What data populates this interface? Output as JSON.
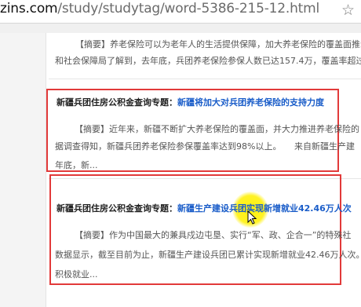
{
  "browser": {
    "url_host": "zins.com",
    "url_path": "/study/studytag/word-5386-215-12.html"
  },
  "article1": {
    "line1": "【摘要】养老保险可以为老年人的生活提供保障，加大养老保险的覆盖面推动",
    "line2": "和社会保障局了解到，去年底，兵团养老保险参保人数已达157.4万，覆盖率超过"
  },
  "article2": {
    "header": "新疆兵团住房公积金查询专题：",
    "link": "新疆将加大对兵团养老保险的支持力度",
    "line1": "【摘要】近年来，新疆不断扩大养老保险的覆盖面，并大力推进养老保险的",
    "line2": "据调查得知，新疆兵团养老保险参保覆盖率达到98%以上。　　来自新疆生产建",
    "line3": "年底，新..."
  },
  "article3": {
    "header": "新疆兵团住房公积金查询专题：",
    "link": "新疆生产建设兵团实现新增就业42.46万人次",
    "line1": "【摘要】作为中国最大的兼具戍边屯垦、实行“军、政、企合一”的特殊社",
    "line2": "数据显示，截至目前为止，新疆生产建设兵团已累计实现新增就业42.46万人次。",
    "line3": "积极就业..."
  },
  "colors": {
    "highlight_box": "#e23a3a",
    "link": "#1a5dc9",
    "cursor_highlight": "#fff200"
  }
}
